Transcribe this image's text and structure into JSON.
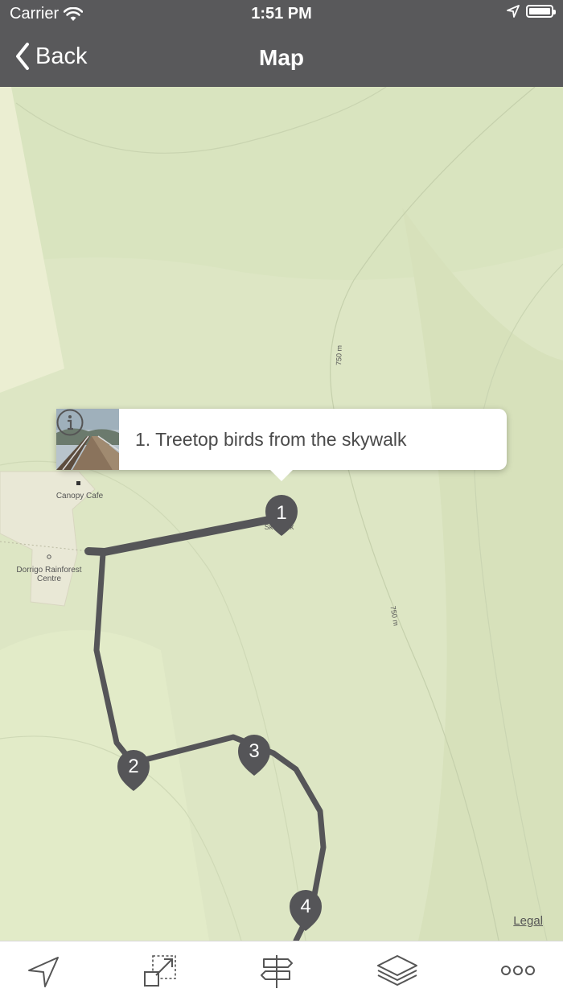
{
  "status_bar": {
    "carrier": "Carrier",
    "time": "1:51 PM"
  },
  "nav": {
    "back_label": "Back",
    "title": "Map"
  },
  "map": {
    "callout": {
      "title": "1. Treetop birds from the skywalk"
    },
    "labels": {
      "canopy_cafe": "Canopy Cafe",
      "rainforest_centre_line1": "Dorrigo Rainforest",
      "rainforest_centre_line2": "Centre",
      "contour_1": "750 m",
      "contour_2": "750 m",
      "skywalk": "Sk",
      "skywalk_end": "lk"
    },
    "markers": [
      "1",
      "2",
      "3",
      "4"
    ],
    "legal": "Legal",
    "route_color": "#555558",
    "marker_color": "#555558"
  },
  "tab_bar": {
    "icons": [
      "location-arrow-icon",
      "resize-icon",
      "signpost-icon",
      "layers-icon",
      "more-icon"
    ]
  }
}
